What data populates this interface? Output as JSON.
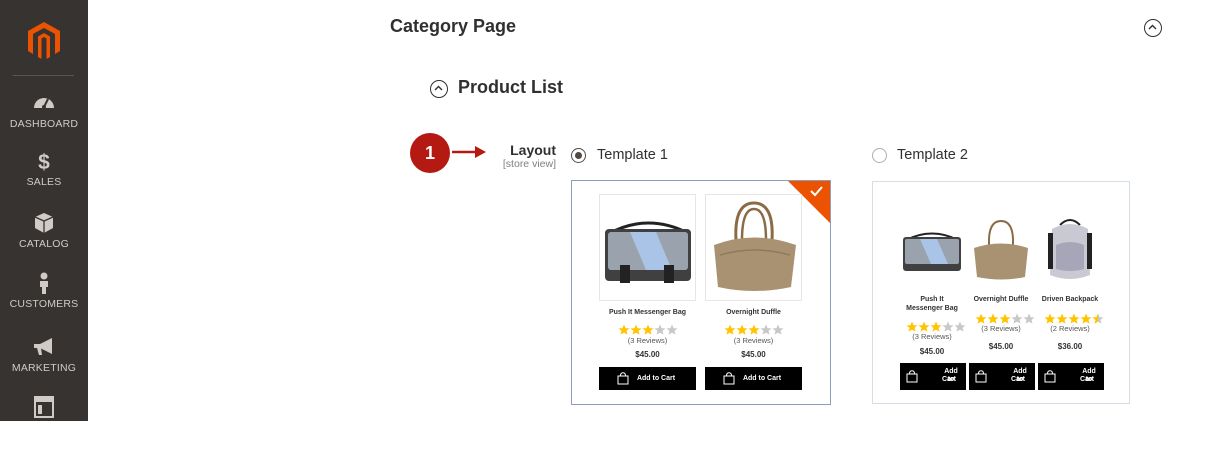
{
  "sidebar": {
    "items": [
      {
        "label": "DASHBOARD",
        "icon": "dashboard-icon"
      },
      {
        "label": "SALES",
        "icon": "dollar-icon"
      },
      {
        "label": "CATALOG",
        "icon": "box-icon"
      },
      {
        "label": "CUSTOMERS",
        "icon": "person-icon"
      },
      {
        "label": "MARKETING",
        "icon": "megaphone-icon"
      },
      {
        "label": "",
        "icon": "content-icon"
      }
    ],
    "colors": {
      "background": "#373330",
      "accent": "#eb5202"
    }
  },
  "section": {
    "title": "Category Page"
  },
  "subsection": {
    "title": "Product List"
  },
  "callout": {
    "number": "1",
    "color": "#b41a11"
  },
  "field": {
    "label": "Layout",
    "scope": "[store view]"
  },
  "templates": [
    {
      "label": "Template 1",
      "selected": true,
      "products": [
        {
          "name": "Push It Messenger Bag",
          "rating": 3,
          "reviews": "(3 Reviews)",
          "price": "$45.00",
          "button": "Add to Cart"
        },
        {
          "name": "Overnight Duffle",
          "rating": 3,
          "reviews": "(3 Reviews)",
          "price": "$45.00",
          "button": "Add to Cart"
        }
      ]
    },
    {
      "label": "Template 2",
      "selected": false,
      "products": [
        {
          "name_line1": "Push It",
          "name_line2": "Messenger Bag",
          "rating": 3,
          "reviews": "(3 Reviews)",
          "price": "$45.00",
          "button_line1": "Add to",
          "button_line2": "Cart"
        },
        {
          "name": "Overnight Duffle",
          "rating": 3,
          "reviews": "(3 Reviews)",
          "price": "$45.00",
          "button_line1": "Add to",
          "button_line2": "Cart"
        },
        {
          "name": "Driven Backpack",
          "rating": 4.5,
          "reviews": "(2 Reviews)",
          "price": "$36.00",
          "button_line1": "Add to",
          "button_line2": "Cart"
        }
      ]
    }
  ]
}
